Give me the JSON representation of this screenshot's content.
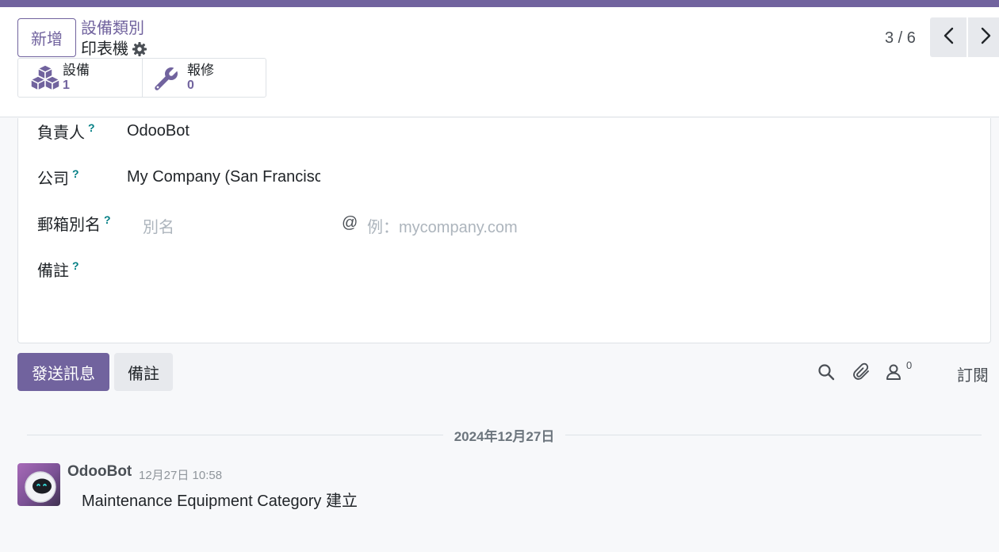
{
  "header": {
    "new_button": "新增",
    "breadcrumb": "設備類別",
    "record_title": "印表機",
    "icons": {
      "gear": "gear-icon"
    }
  },
  "stat_buttons": [
    {
      "label": "設備",
      "value": "1",
      "icon": "cubes-icon"
    },
    {
      "label": "報修",
      "value": "0",
      "icon": "wrench-icon"
    }
  ],
  "pager": {
    "value": "3 / 6"
  },
  "form": {
    "responsible": {
      "label": "負責人",
      "tip": "?",
      "value": "OdooBot"
    },
    "company": {
      "label": "公司",
      "tip": "?",
      "value": "My Company (San Francisco)"
    },
    "email_alias": {
      "label": "郵箱別名",
      "tip": "?",
      "alias_placeholder": "別名",
      "at": "@",
      "domain_placeholder": "例：mycompany.com"
    },
    "note": {
      "label": "備註",
      "tip": "?"
    }
  },
  "chatter": {
    "send_message": "發送訊息",
    "log_note": "備註",
    "follower_count": "0",
    "follow": "訂閱",
    "date_separator": "2024年12月27日",
    "messages": [
      {
        "author": "OdooBot",
        "date": "12月27日 10:58",
        "body": "Maintenance Equipment Category 建立"
      }
    ]
  },
  "colors": {
    "brand": "#71639e",
    "tooltip": "#017e84"
  }
}
